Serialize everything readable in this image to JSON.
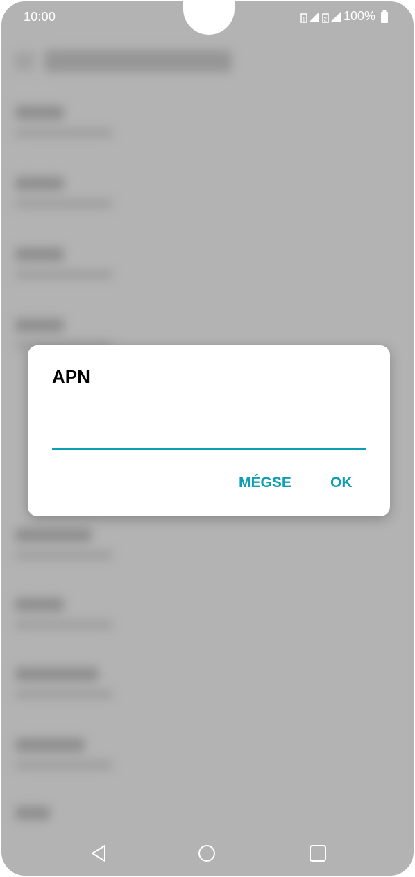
{
  "status_bar": {
    "time": "10:00",
    "battery": "100%"
  },
  "dialog": {
    "title": "APN",
    "input_value": "",
    "cancel_label": "MÉGSE",
    "ok_label": "OK"
  },
  "nav_bar": {
    "back_icon": "back-triangle-icon",
    "home_icon": "home-circle-icon",
    "recents_icon": "recents-square-icon"
  },
  "colors": {
    "accent": "#0f9fb3",
    "overlay": "#b3b3b3",
    "dialog_bg": "#ffffff"
  }
}
